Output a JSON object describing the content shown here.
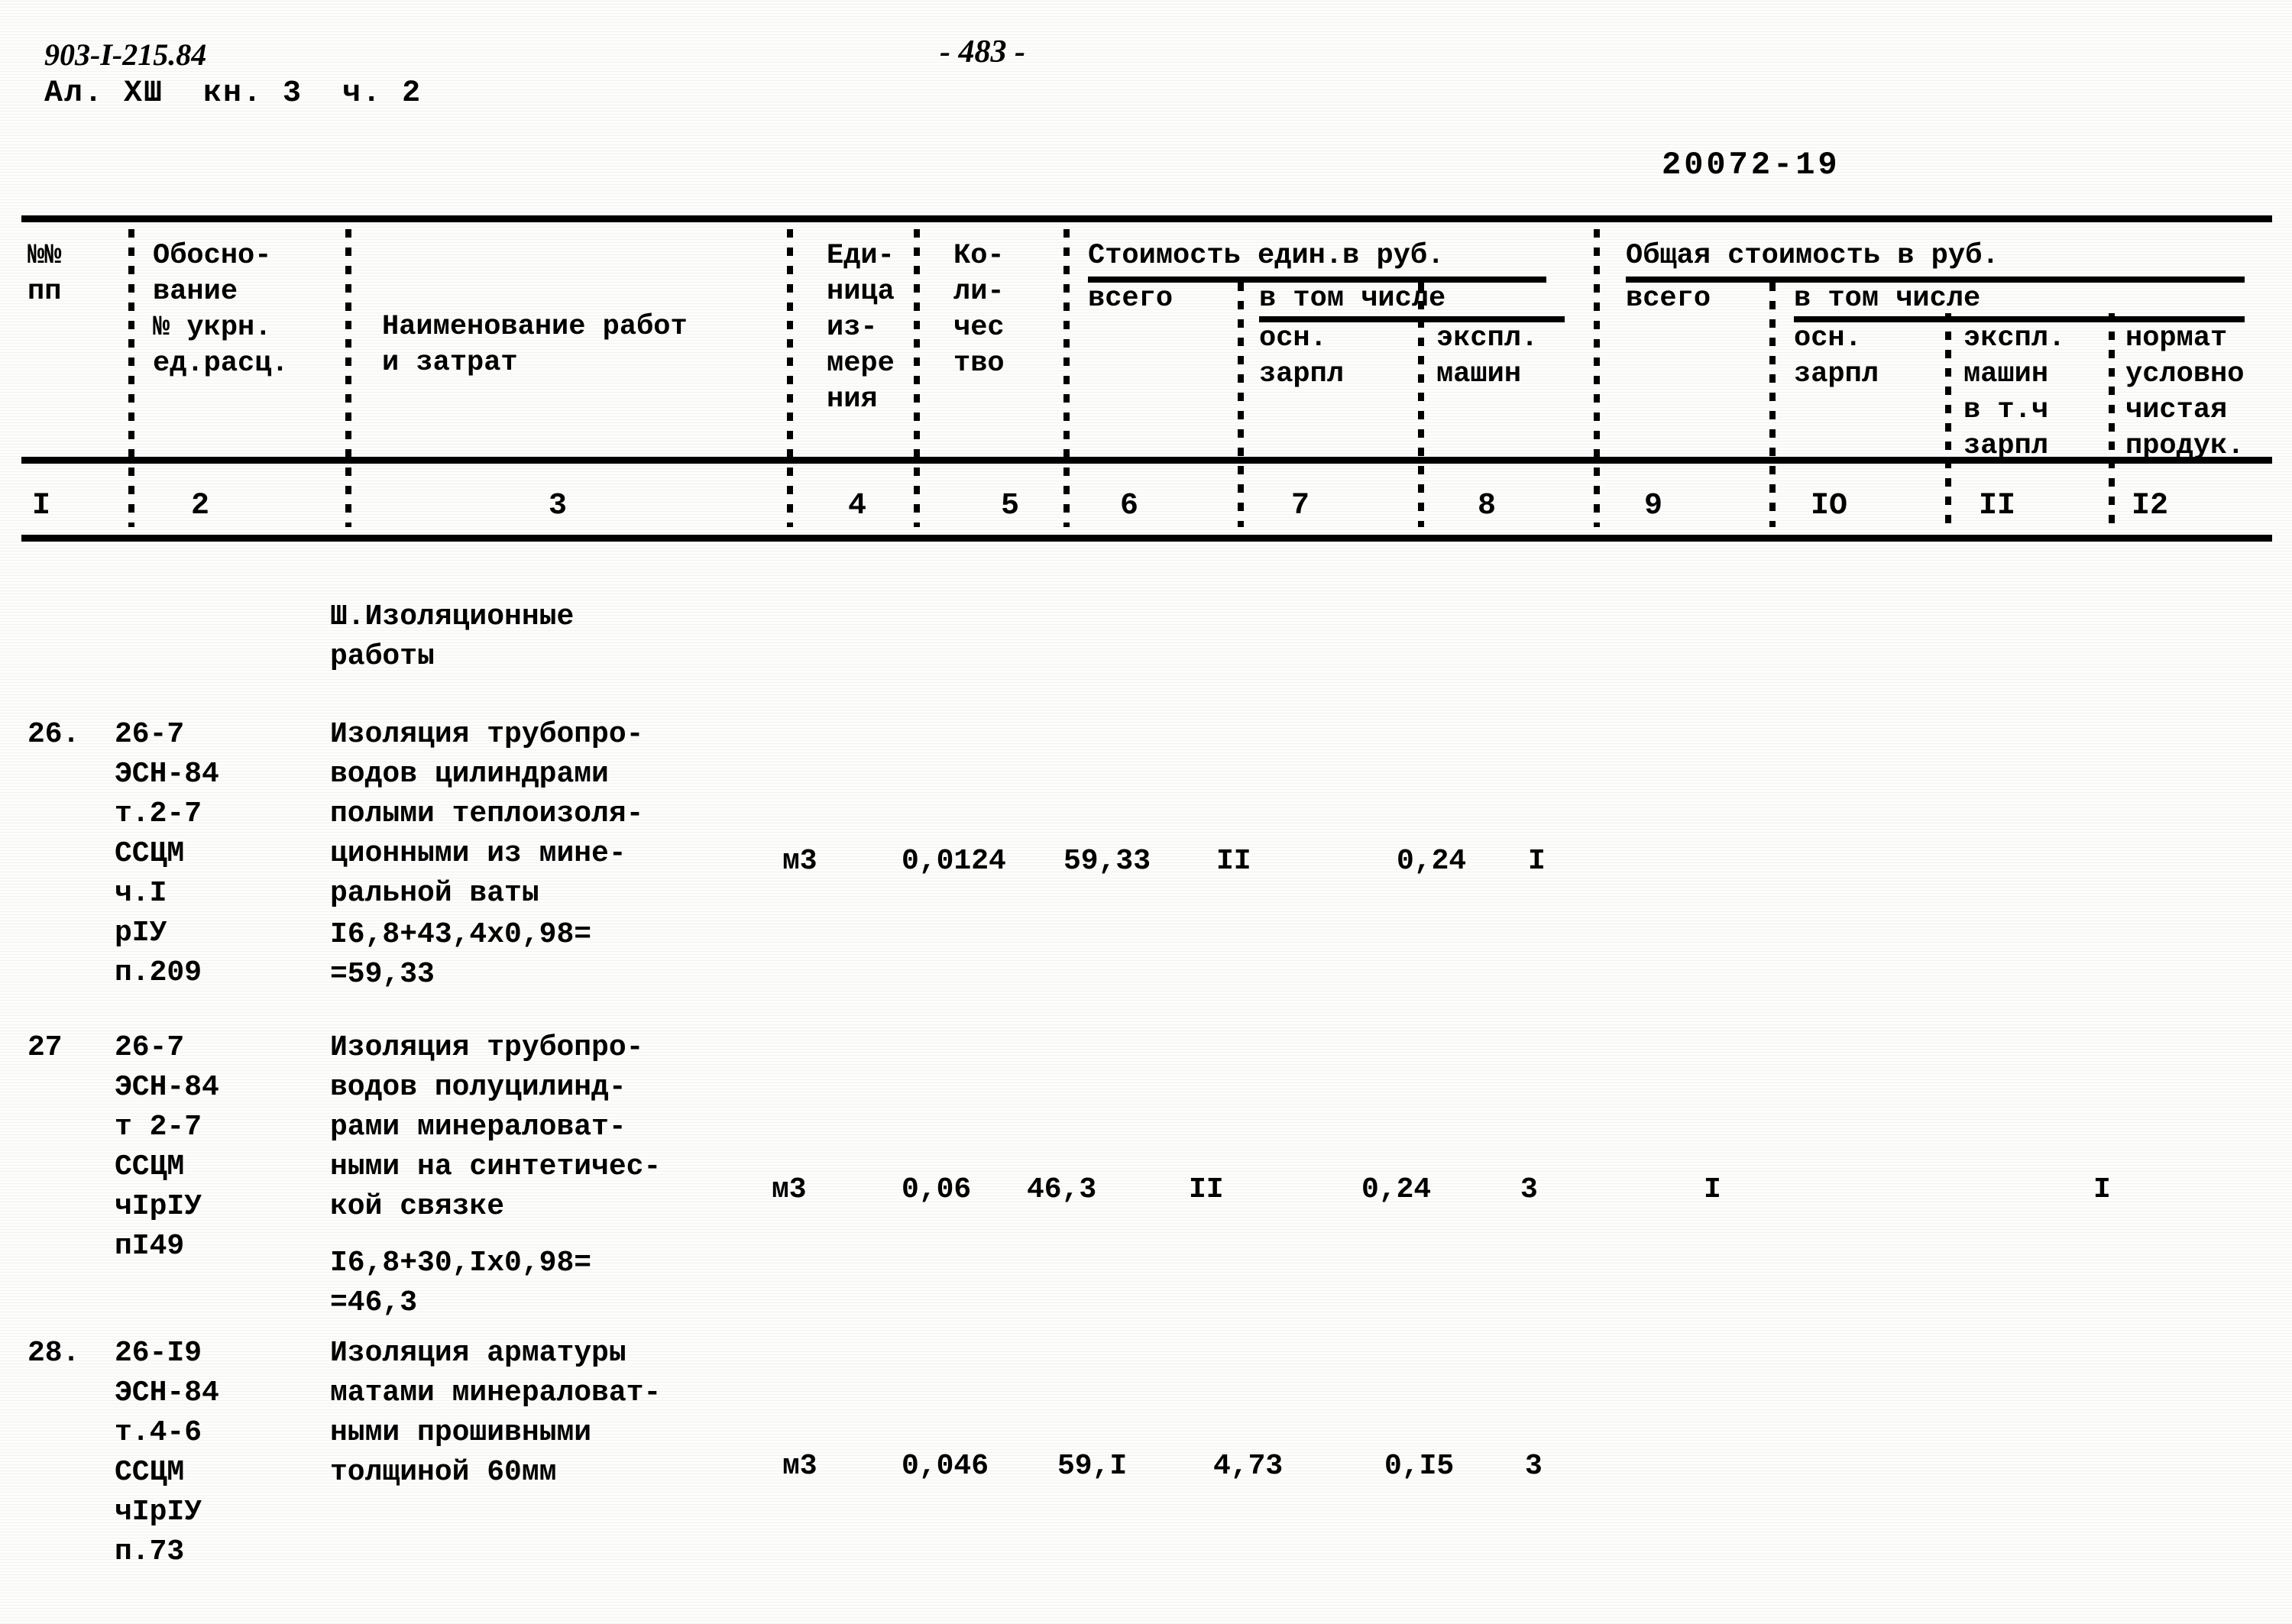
{
  "document": {
    "code": "903-I-215.84",
    "subtitle": "Ал. ХШ  кн. 3  ч. 2",
    "page_number": "- 483 -",
    "sheet_code": "20072-19"
  },
  "table": {
    "header": {
      "col1": "№№\nпп",
      "col2": "Обосно-\nвание\n№ укрн.\nед.расц.",
      "col3": "Наименование работ\nи затрат",
      "col4": "Еди-\nница\nиз-\nмере\nния",
      "col5": "Ко-\nли-\nчес\nтво",
      "group_unit_cost": "Стоимость един.в руб.",
      "col6": "всего",
      "group_unit_incl": "в том числе",
      "col7": "осн.\nзарпл",
      "col8": "экспл.\nмашин",
      "group_total_cost": "Общая стоимость в руб.",
      "col9": "всего",
      "group_total_incl": "в том числе",
      "col10": "осн.\nзарпл",
      "col11": "экспл.\nмашин\nв т.ч\nзарпл",
      "col12": "нормат\nусловно\nчистая\nпродук."
    },
    "column_numbers": [
      "I",
      "2",
      "3",
      "4",
      "5",
      "6",
      "7",
      "8",
      "9",
      "IO",
      "II",
      "I2"
    ],
    "section_title": "Ш.Изоляционные\nработы",
    "rows": [
      {
        "no": "26.",
        "basis": "26-7\nЭСН-84\nт.2-7\nССЦМ\nч.I\nрIУ\nп.209",
        "name": "Изоляция трубопро-\nводов цилиндрами\nполыми теплоизоля-\nционными из мине-\nральной ваты",
        "formula": "I6,8+43,4х0,98=\n=59,33",
        "unit": "м3",
        "qty": "0,0124",
        "unit_total": "59,33",
        "unit_osn_zarpl": "II",
        "unit_exp_mashin": "0,24",
        "total_all": "I",
        "total_osn_zarpl": "",
        "total_exp_mashin": "",
        "total_nuchp": ""
      },
      {
        "no": "27",
        "basis": "26-7\nЭСН-84\nт 2-7\nССЦМ\nчIрIУ\nпI49",
        "name": "Изоляция трубопро-\nводов полуцилинд-\nрами минераловат-\nными на синтетичес-\nкой связке",
        "formula": "I6,8+30,Iх0,98=\n=46,3",
        "unit": "м3",
        "qty": "0,06",
        "unit_total": "46,3",
        "unit_osn_zarpl": "II",
        "unit_exp_mashin": "0,24",
        "total_all": "3",
        "total_osn_zarpl": "I",
        "total_exp_mashin": "",
        "total_nuchp": "I"
      },
      {
        "no": "28.",
        "basis": "26-I9\nЭСН-84\nт.4-6\nССЦМ\nчIрIУ\nп.73",
        "name": "Изоляция арматуры\nматами минераловат-\nными прошивными\nтолщиной 60мм",
        "formula": "",
        "unit": "м3",
        "qty": "0,046",
        "unit_total": "59,I",
        "unit_osn_zarpl": "4,73",
        "unit_exp_mashin": "0,I5",
        "total_all": "3",
        "total_osn_zarpl": "",
        "total_exp_mashin": "",
        "total_nuchp": ""
      }
    ]
  }
}
